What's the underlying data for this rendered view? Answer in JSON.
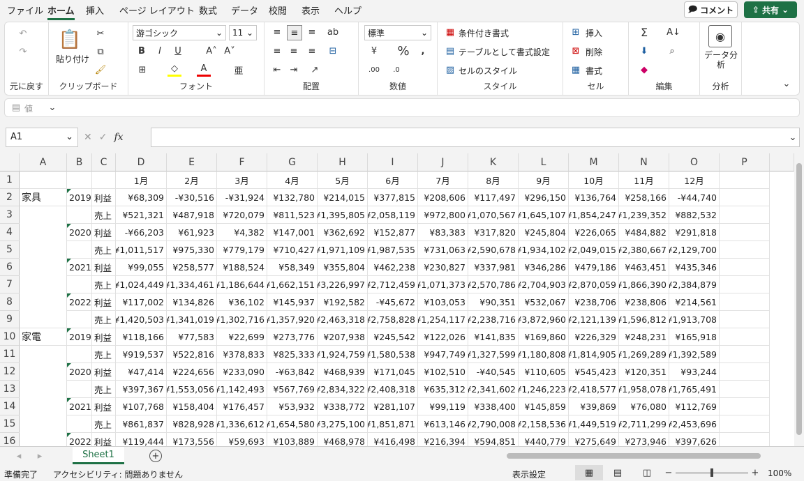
{
  "menu": [
    "ファイル",
    "ホーム",
    "挿入",
    "ページ レイアウト",
    "数式",
    "データ",
    "校閲",
    "表示",
    "ヘルプ"
  ],
  "active_menu": "ホーム",
  "comment_label": "コメント",
  "share_label": "共有",
  "ribbon": {
    "undo_group": "元に戻す",
    "clipboard": {
      "label": "クリップボード",
      "paste": "貼り付け"
    },
    "font": {
      "label": "フォント",
      "name": "游ゴシック",
      "size": "11"
    },
    "align": {
      "label": "配置"
    },
    "number": {
      "label": "数値",
      "format": "標準"
    },
    "style": {
      "label": "スタイル",
      "cond": "条件付き書式",
      "table": "テーブルとして書式設定",
      "cell": "セルのスタイル"
    },
    "cells": {
      "label": "セル",
      "insert": "挿入",
      "delete": "削除",
      "format": "書式"
    },
    "edit": {
      "label": "編集"
    },
    "analysis": {
      "label": "分析",
      "button": "データ分析"
    }
  },
  "qat_value_label": "値",
  "namebox": "A1",
  "columns": [
    "A",
    "B",
    "C",
    "D",
    "E",
    "F",
    "G",
    "H",
    "I",
    "J",
    "K",
    "L",
    "M",
    "N",
    "O",
    "P"
  ],
  "months": [
    "1月",
    "2月",
    "3月",
    "4月",
    "5月",
    "6月",
    "7月",
    "8月",
    "9月",
    "10月",
    "11月",
    "12月"
  ],
  "rows": [
    {
      "n": "2",
      "a": "家具",
      "b": "2019",
      "c": "利益",
      "v": [
        "¥68,309",
        "-¥30,516",
        "-¥31,924",
        "¥132,780",
        "¥214,015",
        "¥377,815",
        "¥208,606",
        "¥117,497",
        "¥296,150",
        "¥136,764",
        "¥258,166",
        "-¥44,740"
      ]
    },
    {
      "n": "3",
      "a": "",
      "b": "",
      "c": "売上",
      "v": [
        "¥521,321",
        "¥487,918",
        "¥720,079",
        "¥811,523",
        "¥1,395,805",
        "¥2,058,119",
        "¥972,800",
        "¥1,070,567",
        "¥1,645,107",
        "¥1,854,247",
        "¥1,239,352",
        "¥882,532"
      ]
    },
    {
      "n": "4",
      "a": "",
      "b": "2020",
      "c": "利益",
      "v": [
        "-¥66,203",
        "¥61,923",
        "¥4,382",
        "¥147,001",
        "¥362,692",
        "¥152,877",
        "¥83,383",
        "¥317,820",
        "¥245,804",
        "¥226,065",
        "¥484,882",
        "¥291,818"
      ]
    },
    {
      "n": "5",
      "a": "",
      "b": "",
      "c": "売上",
      "v": [
        "¥1,011,517",
        "¥975,330",
        "¥779,179",
        "¥710,427",
        "¥1,971,109",
        "¥1,987,535",
        "¥731,063",
        "¥2,590,678",
        "¥1,934,102",
        "¥2,049,015",
        "¥2,380,667",
        "¥2,129,700"
      ]
    },
    {
      "n": "6",
      "a": "",
      "b": "2021",
      "c": "利益",
      "v": [
        "¥99,055",
        "¥258,577",
        "¥188,524",
        "¥58,349",
        "¥355,804",
        "¥462,238",
        "¥230,827",
        "¥337,981",
        "¥346,286",
        "¥479,186",
        "¥463,451",
        "¥435,346"
      ]
    },
    {
      "n": "7",
      "a": "",
      "b": "",
      "c": "売上",
      "v": [
        "¥1,024,449",
        "¥1,334,461",
        "¥1,186,644",
        "¥1,662,151",
        "¥3,226,997",
        "¥2,712,459",
        "¥1,071,373",
        "¥2,570,786",
        "¥2,704,903",
        "¥2,870,059",
        "¥1,866,390",
        "¥2,384,879"
      ]
    },
    {
      "n": "8",
      "a": "",
      "b": "2022",
      "c": "利益",
      "v": [
        "¥117,002",
        "¥134,826",
        "¥36,102",
        "¥145,937",
        "¥192,582",
        "-¥45,672",
        "¥103,053",
        "¥90,351",
        "¥532,067",
        "¥238,706",
        "¥238,806",
        "¥214,561"
      ]
    },
    {
      "n": "9",
      "a": "",
      "b": "",
      "c": "売上",
      "v": [
        "¥1,420,503",
        "¥1,341,019",
        "¥1,302,716",
        "¥1,357,920",
        "¥2,463,318",
        "¥2,758,828",
        "¥1,254,117",
        "¥2,238,716",
        "¥3,872,960",
        "¥2,121,139",
        "¥1,596,812",
        "¥1,913,708"
      ]
    },
    {
      "n": "10",
      "a": "家電",
      "b": "2019",
      "c": "利益",
      "v": [
        "¥118,166",
        "¥77,583",
        "¥22,699",
        "¥273,776",
        "¥207,938",
        "¥245,542",
        "¥122,026",
        "¥141,835",
        "¥169,860",
        "¥226,329",
        "¥248,231",
        "¥165,918"
      ]
    },
    {
      "n": "11",
      "a": "",
      "b": "",
      "c": "売上",
      "v": [
        "¥919,537",
        "¥522,816",
        "¥378,833",
        "¥825,333",
        "¥1,924,759",
        "¥1,580,538",
        "¥947,749",
        "¥1,327,599",
        "¥1,180,808",
        "¥1,814,905",
        "¥1,269,289",
        "¥1,392,589"
      ]
    },
    {
      "n": "12",
      "a": "",
      "b": "2020",
      "c": "利益",
      "v": [
        "¥47,414",
        "¥224,656",
        "¥233,090",
        "-¥63,842",
        "¥468,939",
        "¥171,045",
        "¥102,510",
        "-¥40,545",
        "¥110,605",
        "¥545,423",
        "¥120,351",
        "¥93,244"
      ]
    },
    {
      "n": "13",
      "a": "",
      "b": "",
      "c": "売上",
      "v": [
        "¥397,367",
        "¥1,553,056",
        "¥1,142,493",
        "¥567,769",
        "¥2,834,322",
        "¥2,408,318",
        "¥635,312",
        "¥2,341,602",
        "¥1,246,223",
        "¥2,418,577",
        "¥1,958,078",
        "¥1,765,491"
      ]
    },
    {
      "n": "14",
      "a": "",
      "b": "2021",
      "c": "利益",
      "v": [
        "¥107,768",
        "¥158,404",
        "¥176,457",
        "¥53,932",
        "¥338,772",
        "¥281,107",
        "¥99,119",
        "¥338,400",
        "¥145,859",
        "¥39,869",
        "¥76,080",
        "¥112,769"
      ]
    },
    {
      "n": "15",
      "a": "",
      "b": "",
      "c": "売上",
      "v": [
        "¥861,837",
        "¥828,928",
        "¥1,336,612",
        "¥1,654,580",
        "¥3,275,100",
        "¥1,851,871",
        "¥613,146",
        "¥2,790,008",
        "¥2,158,536",
        "¥1,449,519",
        "¥2,711,299",
        "¥2,453,696"
      ]
    },
    {
      "n": "16",
      "a": "",
      "b": "2022",
      "c": "利益",
      "v": [
        "¥119,444",
        "¥173,556",
        "¥59,693",
        "¥103,889",
        "¥468,978",
        "¥416,498",
        "¥216,394",
        "¥594,851",
        "¥440,779",
        "¥275,649",
        "¥273,946",
        "¥397,626"
      ]
    }
  ],
  "sheet_tab": "Sheet1",
  "status": {
    "ready": "準備完了",
    "accessibility": "アクセシビリティ: 問題ありません",
    "display_settings": "表示設定",
    "zoom": "100%"
  }
}
